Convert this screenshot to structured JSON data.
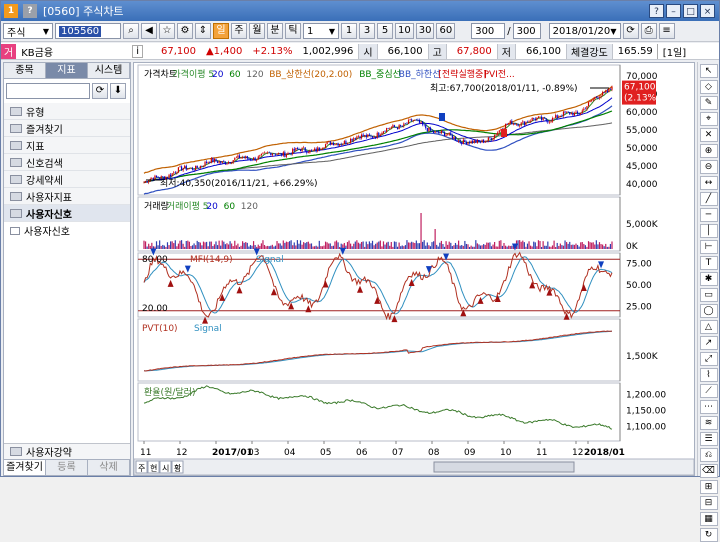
{
  "title": "[0560] 주식차트",
  "title_num": "1",
  "toolbar": {
    "market": "주식",
    "code": "105560",
    "period_buttons": [
      "주",
      "월",
      "분",
      "틱"
    ],
    "day_label": "일",
    "count_value": "1",
    "intervals": [
      "1",
      "3",
      "5",
      "10",
      "30",
      "60"
    ],
    "bars_value": "300",
    "bars_total": "300",
    "date_value": "2018/01/20"
  },
  "quote": {
    "badge": "거",
    "name": "KB금융",
    "info_icon": "i",
    "price": "67,100",
    "change": "▲1,400",
    "pct": "+2.13%",
    "volume": "1,002,996",
    "open_label": "시",
    "open": "66,100",
    "high_label": "고",
    "high": "67,800",
    "low_label": "저",
    "low": "66,100",
    "strength_label": "체결강도",
    "strength": "165.59",
    "period_tag": "[1일]"
  },
  "left": {
    "tabs": [
      "종목",
      "지표",
      "시스템"
    ],
    "tree": [
      "유형",
      "즐겨찾기",
      "지표",
      "신호검색",
      "강세약세",
      "사용자지표",
      "사용자신호"
    ],
    "sub_item": "사용자신호",
    "bottom_item": "사용자강약",
    "bottom_tabs": [
      "즐겨찾기",
      "등록",
      "삭제"
    ]
  },
  "chart_data": [
    {
      "type": "line",
      "title": "가격차트",
      "legend": [
        "가격차트",
        "가격이평 5",
        "20",
        "60",
        "120",
        "BB_상한선(20,2.00)",
        "BB_중심선",
        "BB_하한선",
        "[전략실행중]",
        "PVI전..."
      ],
      "y_ticks": [
        "70,000",
        "65,000",
        "60,000",
        "55,000",
        "50,000",
        "45,000",
        "40,000"
      ],
      "ylim": [
        38000,
        72000
      ],
      "last_price_label": "67,100",
      "last_pct_label": "(2.13%)",
      "annotations": [
        "최고:67,700(2018/01/11, -0.89%)",
        "최저:40,350(2016/11/21, +66.29%)"
      ],
      "x_start": "2016/11",
      "x_end": "2018/01",
      "anchor_points": [
        {
          "x": "2016/11",
          "y": 40350
        },
        {
          "x": "2016/12",
          "y": 43500
        },
        {
          "x": "2017/01",
          "y": 46000
        },
        {
          "x": "2017/02",
          "y": 47000
        },
        {
          "x": "2017/03",
          "y": 48500
        },
        {
          "x": "2017/04",
          "y": 49500
        },
        {
          "x": "2017/05",
          "y": 52000
        },
        {
          "x": "2017/06",
          "y": 54000
        },
        {
          "x": "2017/07",
          "y": 57500
        },
        {
          "x": "2017/08",
          "y": 53500
        },
        {
          "x": "2017/09",
          "y": 51000
        },
        {
          "x": "2017/10",
          "y": 57000
        },
        {
          "x": "2017/11",
          "y": 58000
        },
        {
          "x": "2017/12",
          "y": 60000
        },
        {
          "x": "2018/01",
          "y": 67100
        }
      ]
    },
    {
      "type": "bar",
      "title": "거래량",
      "legend": [
        "거래량",
        "거래이평 5",
        "20",
        "60",
        "120"
      ],
      "y_ticks": [
        "5,000K",
        "0K"
      ]
    },
    {
      "type": "line",
      "title": "MFI(14,9)",
      "legend": [
        "MFI(14,9)",
        "Signal"
      ],
      "y_ticks": [
        "75.00",
        "50.00",
        "25.00"
      ],
      "levels": [
        "80.00",
        "20.00"
      ],
      "ylim": [
        15,
        85
      ]
    },
    {
      "type": "line",
      "title": "PVT(10)",
      "legend": [
        "PVT(10)",
        "Signal"
      ],
      "y_ticks": [
        "1,500K"
      ]
    },
    {
      "type": "line",
      "title": "환율(원/달러)",
      "legend": [
        "환율(원/달러)"
      ],
      "y_ticks": [
        "1,200.00",
        "1,150.00",
        "1,100.00"
      ],
      "ylim": [
        1060,
        1230
      ]
    }
  ],
  "x_axis_labels": [
    "11",
    "12",
    "2017/01",
    "03",
    "04",
    "05",
    "06",
    "07",
    "08",
    "09",
    "10",
    "11",
    "12",
    "2018/01"
  ],
  "colors": {
    "price_up": "#d00000",
    "price_down": "#0000cc",
    "ma5": "#2a8a2a",
    "ma20": "#0000cc",
    "ma60": "#008000",
    "bb_upper": "#c06000",
    "bb_lower": "#3050c0",
    "exchange": "#3a7a2a",
    "mfi": "#b03020",
    "signal": "#3090c0"
  }
}
